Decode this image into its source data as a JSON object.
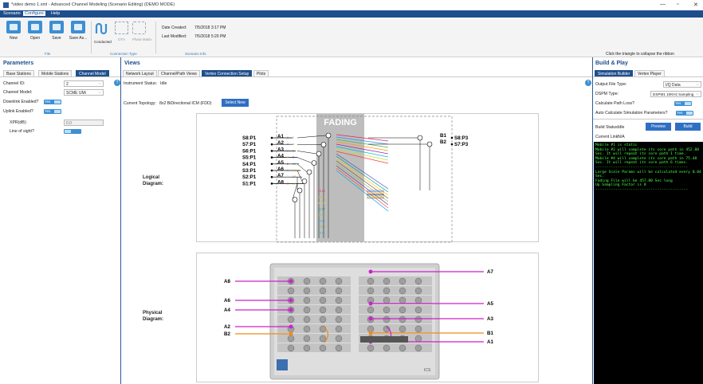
{
  "window": {
    "title": "*video demo 1.xml - Advanced Channel Modeling (Scenario Editing) (DEMO MODE)",
    "minimize": "—",
    "maximize": "▫",
    "close": "✕"
  },
  "menu": [
    "Scenario",
    "Configure",
    "Help"
  ],
  "ribbon": {
    "file_buttons": [
      "New",
      "Open",
      "Save",
      "Save As..."
    ],
    "file_group": "File",
    "conn_buttons": [
      "Conducted",
      "OTA",
      "Phase Matrix"
    ],
    "conn_group": "Connection Type",
    "date_created_label": "Date Created:",
    "date_created": "7/5/2018 3:17 PM",
    "last_modified_label": "Last Modified:",
    "last_modified": "7/5/2018 5:20 PM",
    "scenario_group": "Scenario Info",
    "collapse_hint": "Click the triangle to collapse the ribbon"
  },
  "parameters": {
    "title": "Parameters",
    "tabs": [
      "Base Stations",
      "Mobile Stations",
      "Channel Model"
    ],
    "channel_id_label": "Channel ID:",
    "channel_id": "2",
    "channel_model_label": "Channel Model:",
    "channel_model": "SCME UMi",
    "downlink_label": "Downlink Enabled?",
    "downlink_value": "Yes",
    "uplink_label": "Uplink Enabled?",
    "uplink_value": "Yes",
    "xpr_label": "XPR(dB):",
    "xpr_value": "0.0",
    "los_label": "Line of sight?"
  },
  "views": {
    "title": "Views",
    "tabs": [
      "Network Layout",
      "Channel/Path Views",
      "Vertex Connection Setup",
      "Plots"
    ],
    "instrument_status_label": "Instrument Status:",
    "instrument_status": "Idle",
    "topology_label": "Current Topology:",
    "topology": "8x2 BiDirectional ICM (FDD)",
    "select_new": "Select New",
    "logical_label": "Logical\nDiagram:",
    "physical_label": "Physical\nDiagram:",
    "fading": "FADING",
    "left_ports": [
      "S8:P1",
      "S7:P1",
      "S6:P1",
      "S5:P1",
      "S4:P1",
      "S3:P1",
      "S2:P1",
      "S1:P1"
    ],
    "a_labels": [
      "A1",
      "A2",
      "A3",
      "A4",
      "A5",
      "A6",
      "A7",
      "A8"
    ],
    "right_ports": [
      "S8:P3",
      "S7:P3"
    ],
    "b_labels": [
      "B1",
      "B2"
    ],
    "phys_left": [
      "A8",
      "A6",
      "A4",
      "A2",
      "B2"
    ],
    "phys_right": [
      "A7",
      "A5",
      "A3",
      "B1",
      "A1"
    ],
    "chassis_brand": "ICS"
  },
  "build": {
    "title": "Build & Play",
    "tabs": [
      "Simulation Builder",
      "Vertex Player"
    ],
    "output_file_type_label": "Output File Type:",
    "output_file_type": "I/Q Data",
    "dspm_type_label": "DSPM Type:",
    "dspm_type": "DSPM1 10KHz Sampling",
    "calc_path_loss_label": "Calculate Path Loss?",
    "calc_path_loss": "Yes",
    "auto_calc_label": "Auto Calculate Simulation Parameters?",
    "auto_calc": "Yes",
    "build_status_label": "Build Status:",
    "build_status": "Idle",
    "preview": "Preview",
    "build": "Build",
    "current_link_label": "Current Link:",
    "current_link": "N/A",
    "console": [
      "Mobile #1 is static",
      "Mobile #2 will complete its core path in 452.80 Sec. It will repeat its core path 1 time.",
      "Mobile #4 will complete its core path in 75.48 Sec. It will repeat its core path 6 times.",
      "------------------------------------------",
      "Large Scale Params will be calculated every 0.04 Sec.",
      "Fading File will be 457.80 Sec long",
      "Up Sampling Factor is 8",
      "------------------------------------------"
    ]
  },
  "colors": {
    "accent": "#1f4e8c",
    "console_bg": "#000000",
    "console_text": "#4cff4c",
    "magenta": "#cc22cc",
    "orange": "#f08a1a"
  }
}
